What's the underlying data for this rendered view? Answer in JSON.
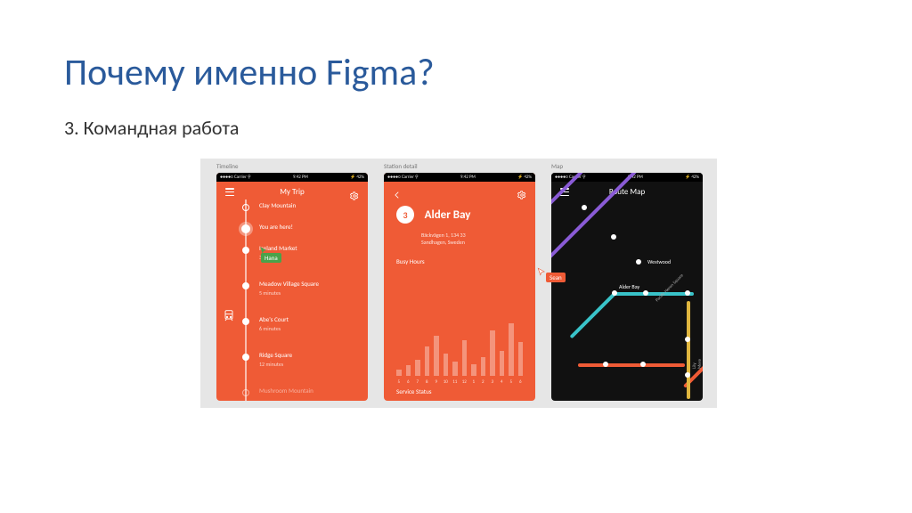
{
  "slide": {
    "title": "Почему именно Figma?",
    "subtitle": "3. Командная работа"
  },
  "canvas": {
    "frame_labels": {
      "timeline": "Timeline",
      "detail": "Station detail",
      "map": "Map"
    }
  },
  "statusbar": {
    "carrier": "●●●●○ Carrier ⚲",
    "time": "9:42 PM",
    "battery": "⚡ 42%"
  },
  "cursors": {
    "p1": {
      "name": "Hana",
      "color": "green"
    },
    "p3": {
      "name": "Sean",
      "color": "red"
    }
  },
  "phone1": {
    "title": "My Trip",
    "stops": [
      {
        "name": "Clay Mountain",
        "sub": ""
      },
      {
        "name": "You are here!",
        "sub": ""
      },
      {
        "name": "Iceland Market",
        "sub": "3 minutes"
      },
      {
        "name": "Meadow Village Square",
        "sub": "5 minutes"
      },
      {
        "name": "Abe's Court",
        "sub": "6 minutes"
      },
      {
        "name": "Ridge Square",
        "sub": "12 minutes"
      },
      {
        "name": "Mushroom Mountain",
        "sub": ""
      }
    ]
  },
  "phone2": {
    "back": "‹",
    "badge": "3",
    "title": "Alder Bay",
    "address_line1": "Bäckvägen 1, 134 33",
    "address_line2": "Sandhagen, Sweden",
    "busy_label": "Busy Hours",
    "svc_label": "Service Status"
  },
  "chart_data": {
    "type": "bar",
    "categories": [
      "5",
      "6",
      "7",
      "8",
      "9",
      "10",
      "11",
      "12",
      "1",
      "2",
      "3",
      "4",
      "5",
      "6"
    ],
    "values": [
      8,
      14,
      22,
      40,
      55,
      30,
      20,
      48,
      16,
      26,
      62,
      34,
      72,
      46
    ],
    "ylim": [
      0,
      80
    ],
    "title": "Busy Hours",
    "xlabel": "",
    "ylabel": ""
  },
  "phone3": {
    "title": "Route Map",
    "stations": {
      "westwood": "Westwood",
      "alder_bay": "Alder Bay",
      "pacific": "Pacific Heron Square",
      "lily": "Lily Mere"
    },
    "colors": {
      "purple": "#8a5bd6",
      "cyan": "#39c3c9",
      "red": "#ef5b36",
      "yellow": "#e0b63f"
    }
  }
}
